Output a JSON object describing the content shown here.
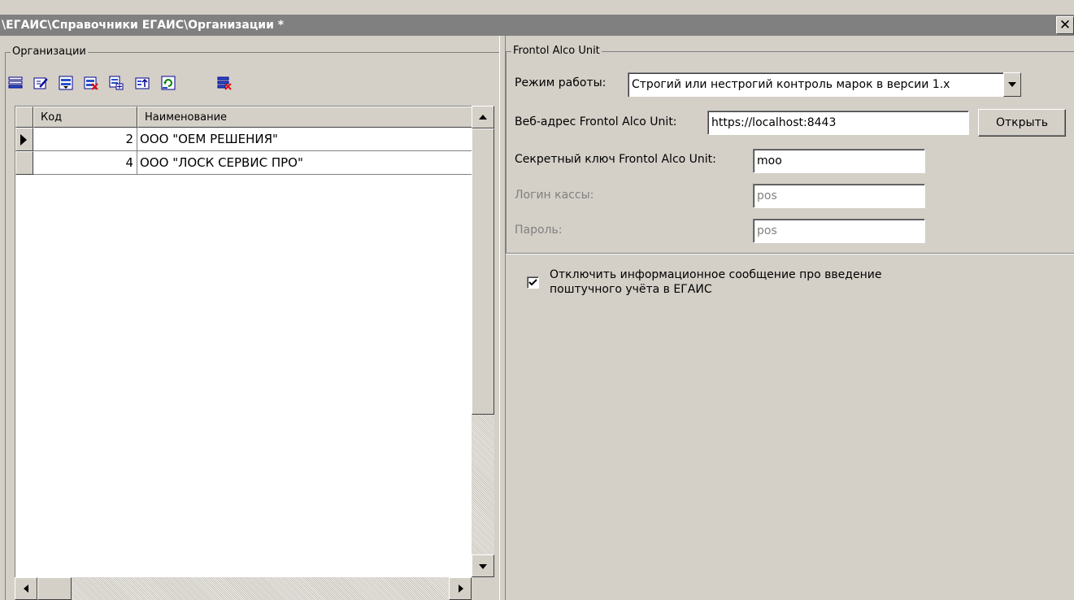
{
  "window": {
    "title": "\\ЕГАИС\\Справочники ЕГАИС\\Организации *",
    "close_glyph": "✕"
  },
  "organizations": {
    "group_label": "Организации",
    "toolbar_icons": [
      "add-record-icon",
      "edit-record-icon",
      "insert-copy-icon",
      "delete-record-icon",
      "copy-record-icon",
      "export-icon",
      "refresh-icon",
      "clear-filter-icon"
    ],
    "columns": [
      "Код",
      "Наименование"
    ],
    "rows": [
      {
        "code": "2",
        "name": "ООО \"ОЕМ РЕШЕНИЯ\"",
        "current": true
      },
      {
        "code": "4",
        "name": "ООО \"ЛОСК СЕРВИС ПРО\"",
        "current": false
      }
    ]
  },
  "frontol": {
    "group_label": "Frontol Alco Unit",
    "mode_label": "Режим работы:",
    "mode_value": "Строгий или нестрогий контроль марок в версии 1.х",
    "url_label": "Веб-адрес Frontol Alco Unit:",
    "url_value": "https://localhost:8443",
    "open_button": "Открыть",
    "secret_label": "Секретный ключ  Frontol Alco Unit:",
    "secret_value": "moo",
    "login_label": "Логин кассы:",
    "login_value": "pos",
    "password_label": "Пароль:",
    "password_value": "pos"
  },
  "options": {
    "disable_info_message_checked": true,
    "disable_info_message_line1": "Отключить информационное сообщение про введение",
    "disable_info_message_line2": "поштучного учёта в ЕГАИС"
  }
}
